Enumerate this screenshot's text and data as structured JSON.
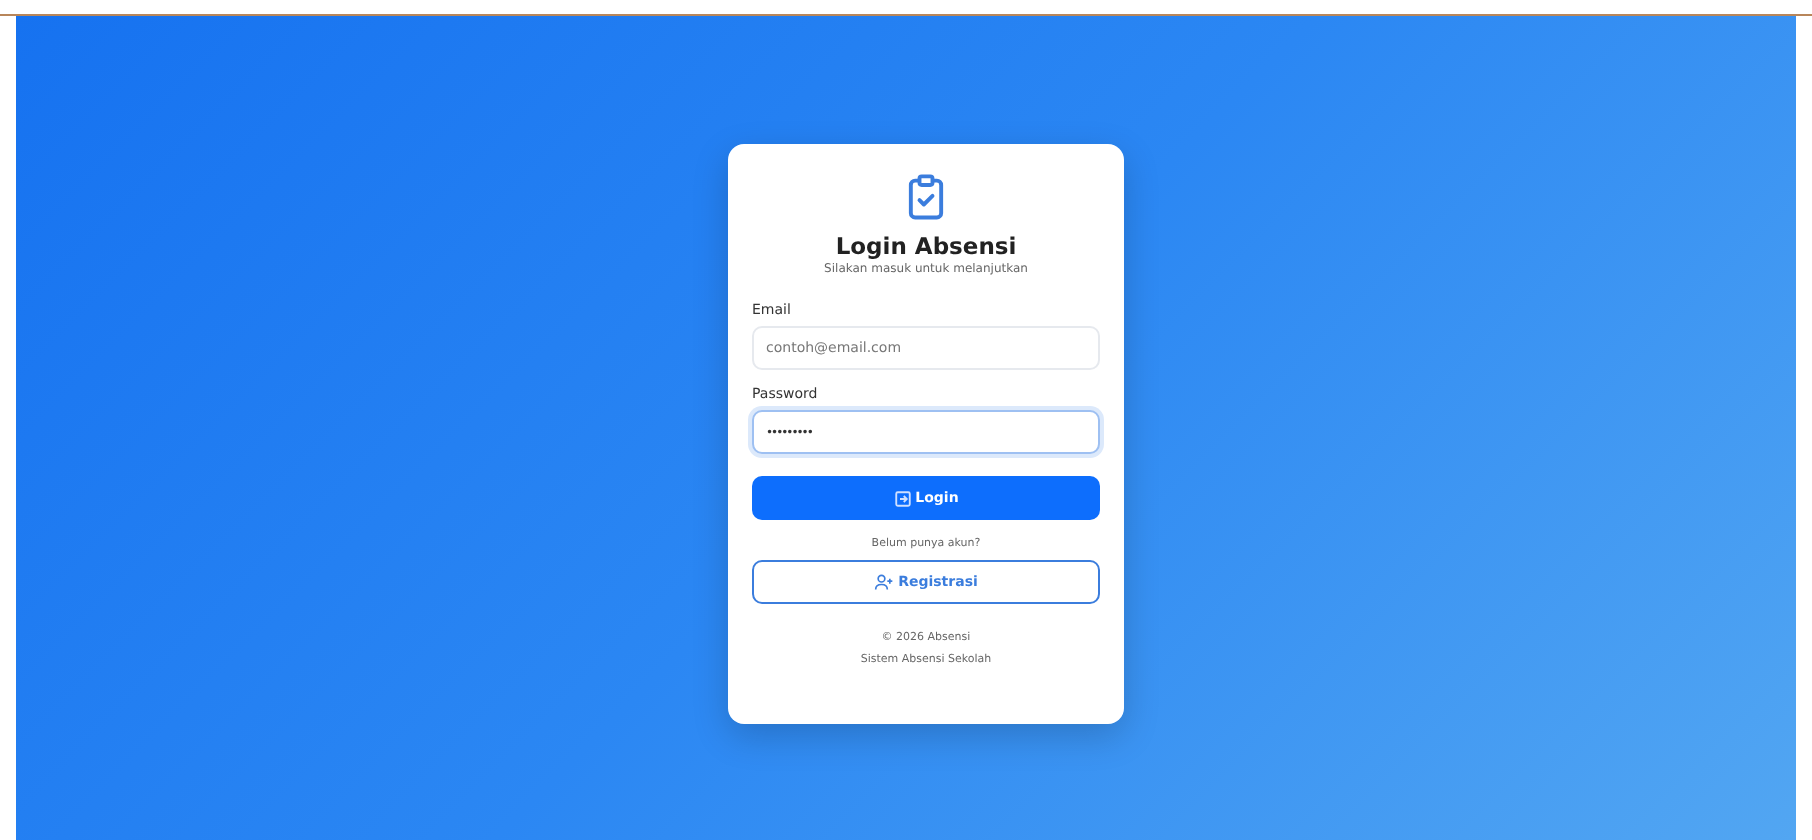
{
  "card": {
    "title": "Login Absensi",
    "subtitle": "Silakan masuk untuk melanjutkan",
    "fields": [
      {
        "label": "Email",
        "placeholder": "contoh@email.com",
        "focused": false
      },
      {
        "label": "Password",
        "value": "•••••••••",
        "focused": true
      }
    ],
    "login_button": "Login",
    "register_prompt": "Belum punya akun?",
    "register_button": "Registrasi",
    "footer": [
      "© 2026 Absensi",
      "Sistem Absensi Sekolah"
    ]
  }
}
